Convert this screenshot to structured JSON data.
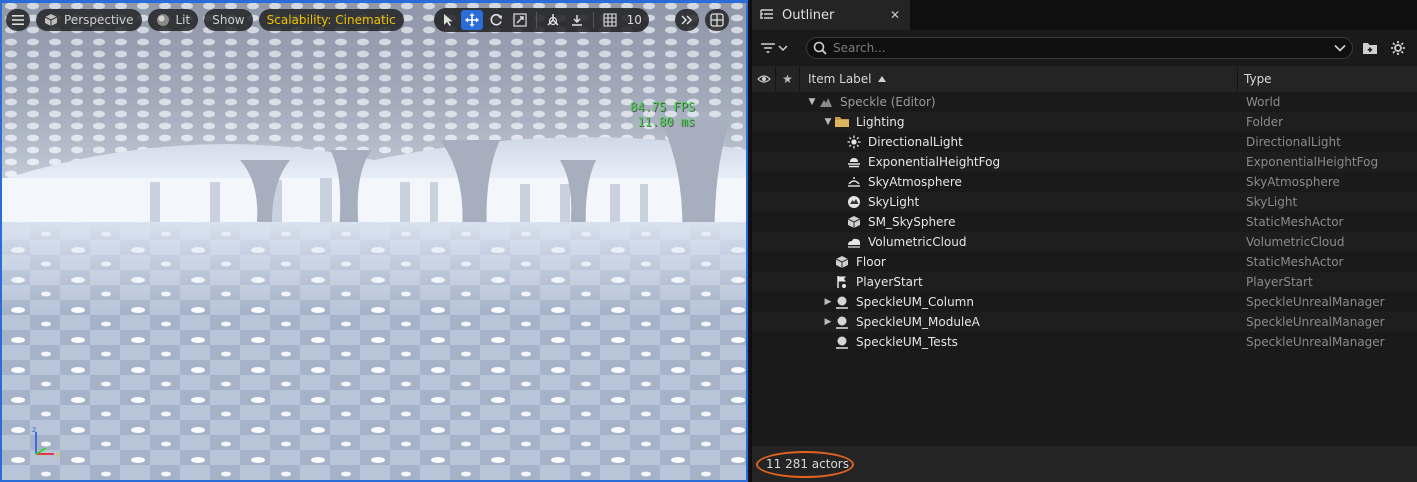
{
  "viewport": {
    "menu_icon": "hamburger-icon",
    "view_mode": "Perspective",
    "lighting": "Lit",
    "show": "Show",
    "scalability": "Scalability: Cinematic",
    "grid_size": "10",
    "fps": "84.75 FPS",
    "frame_ms": "11.80 ms",
    "accent_color": "#2a6cd8",
    "scalability_color": "#f2c200",
    "stats_color": "#46d646"
  },
  "outliner": {
    "tab_title": "Outliner",
    "search_placeholder": "Search...",
    "columns": {
      "label": "Item Label",
      "type": "Type"
    },
    "rows": [
      {
        "label": "Speckle (Editor)",
        "type": "World",
        "icon": "world-icon"
      },
      {
        "label": "Lighting",
        "type": "Folder",
        "icon": "folder-icon"
      },
      {
        "label": "DirectionalLight",
        "type": "DirectionalLight",
        "icon": "sun-icon"
      },
      {
        "label": "ExponentialHeightFog",
        "type": "ExponentialHeightFog",
        "icon": "fog-icon"
      },
      {
        "label": "SkyAtmosphere",
        "type": "SkyAtmosphere",
        "icon": "atmosphere-icon"
      },
      {
        "label": "SkyLight",
        "type": "SkyLight",
        "icon": "skylight-icon"
      },
      {
        "label": "SM_SkySphere",
        "type": "StaticMeshActor",
        "icon": "static-mesh-icon"
      },
      {
        "label": "VolumetricCloud",
        "type": "VolumetricCloud",
        "icon": "cloud-icon"
      },
      {
        "label": "Floor",
        "type": "StaticMeshActor",
        "icon": "static-mesh-icon"
      },
      {
        "label": "PlayerStart",
        "type": "PlayerStart",
        "icon": "player-start-icon"
      },
      {
        "label": "SpeckleUM_Column",
        "type": "SpeckleUnrealManager",
        "icon": "actor-icon"
      },
      {
        "label": "SpeckleUM_ModuleA",
        "type": "SpeckleUnrealManager",
        "icon": "actor-icon"
      },
      {
        "label": "SpeckleUM_Tests",
        "type": "SpeckleUnrealManager",
        "icon": "actor-icon"
      }
    ],
    "status": "11 281 actors",
    "highlight_color": "#e0631f"
  }
}
